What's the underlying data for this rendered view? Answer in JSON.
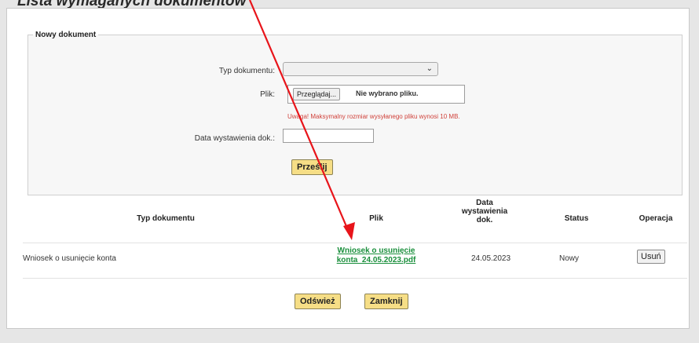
{
  "page": {
    "heading": "Lista wymaganych dokumentów"
  },
  "new_document": {
    "legend": "Nowy dokument",
    "type_label": "Typ dokumentu:",
    "type_selected": "",
    "file_label": "Plik:",
    "browse_label": "Przeglądaj...",
    "file_status": "Nie wybrano pliku.",
    "warning": "Uwaga! Maksymalny rozmiar wysyłanego pliku wynosi 10 MB.",
    "date_label": "Data wystawienia dok.:",
    "date_value": "",
    "submit_label": "Prześlij"
  },
  "table": {
    "columns": {
      "type": "Typ dokumentu",
      "file": "Plik",
      "date_line1": "Data",
      "date_line2": "wystawienia",
      "date_line3": "dok.",
      "status": "Status",
      "operation": "Operacja"
    },
    "rows": [
      {
        "type": "Wniosek o usunięcie konta",
        "file_line1": "Wniosek o usunięcie",
        "file_line2": "konta_24.05.2023.pdf",
        "date": "24.05.2023",
        "status": "Nowy",
        "action": "Usuń"
      }
    ]
  },
  "footer": {
    "refresh_label": "Odśwież",
    "close_label": "Zamknij"
  },
  "colors": {
    "accent_button": "#f6de86",
    "link": "#1a8f3c",
    "warning": "#d0423b",
    "arrow": "#e8141a"
  }
}
